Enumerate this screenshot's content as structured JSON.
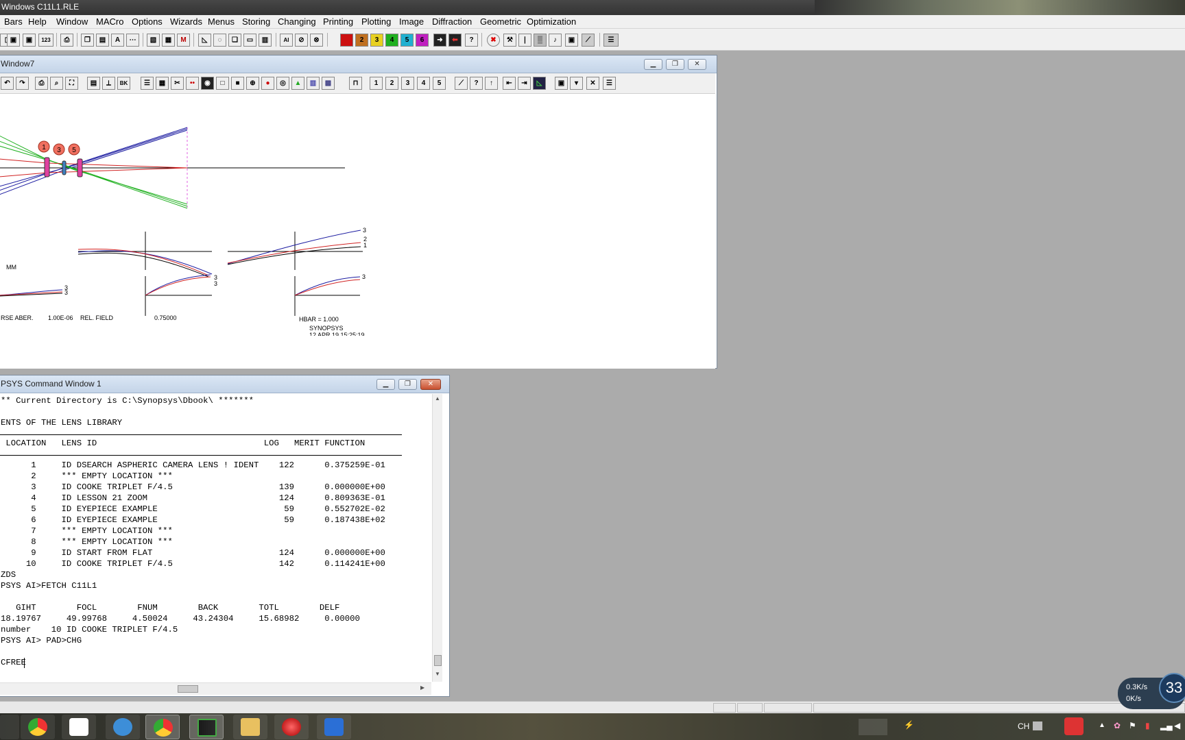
{
  "app": {
    "title": "Windows C11L1.RLE"
  },
  "menubar": {
    "items": [
      "Bars",
      "Help",
      "Window",
      "MACro",
      "Options",
      "Wizards",
      "Menus",
      "Storing",
      "Changing",
      "Printing",
      "Plotting",
      "Image",
      "Diffraction",
      "Geometric",
      "Optimization"
    ]
  },
  "main_toolbar": {
    "numbers_label": "123",
    "color_buttons": [
      {
        "label": "",
        "color": "#cc1010"
      },
      {
        "label": "2",
        "color": "#c07020"
      },
      {
        "label": "3",
        "color": "#e8d020"
      },
      {
        "label": "4",
        "color": "#20b020"
      },
      {
        "label": "5",
        "color": "#20b0d0"
      },
      {
        "label": "6",
        "color": "#c020c0"
      }
    ]
  },
  "graphics_window": {
    "title": "Window7",
    "zoom_tabs": [
      "1",
      "2",
      "3",
      "4",
      "5"
    ],
    "lens_markers": [
      "1",
      "3",
      "5"
    ],
    "units": "MM",
    "fan_labels": {
      "a1": "3",
      "a2": "3",
      "b1": "3",
      "b2": "3",
      "c1": "3",
      "c2": "2",
      "c3": "1",
      "d1": "3"
    },
    "footer": {
      "aber_label": "RSE ABER.",
      "aber_scale": "1.00E-06",
      "rel_field_label": "REL. FIELD",
      "rel_field_value": "0.75000",
      "hbar": "HBAR = 1.000",
      "brand": "SYNOPSYS",
      "date": "12 APR 19  15:25:19"
    }
  },
  "command_window": {
    "title": "PSYS Command Window 1",
    "lines": [
      "** Current Directory is C:\\Synopsys\\Dbook\\ *******",
      "",
      "ENTS OF THE LENS LIBRARY",
      "",
      " LOCATION   LENS ID                                 LOG   MERIT FUNCTION",
      "",
      "      1     ID DSEARCH ASPHERIC CAMERA LENS ! IDENT    122      0.375259E-01",
      "      2     *** EMPTY LOCATION ***",
      "      3     ID COOKE TRIPLET F/4.5                     139      0.000000E+00",
      "      4     ID LESSON 21 ZOOM                          124      0.809363E-01",
      "      5     ID EYEPIECE EXAMPLE                         59      0.552702E-02",
      "      6     ID EYEPIECE EXAMPLE                         59      0.187438E+02",
      "      7     *** EMPTY LOCATION ***",
      "      8     *** EMPTY LOCATION ***",
      "      9     ID START FROM FLAT                         124      0.000000E+00",
      "     10     ID COOKE TRIPLET F/4.5                     142      0.114241E+00",
      "ZDS",
      "PSYS AI>FETCH C11L1",
      "",
      "   GIHT        FOCL        FNUM        BACK        TOTL        DELF",
      "18.19767     49.99768     4.50024     43.24304     15.68982     0.00000",
      "number    10 ID COOKE TRIPLET F/4.5",
      "PSYS AI> PAD>CHG",
      "",
      "CFREE"
    ]
  },
  "system_tray": {
    "language": "CH",
    "net_up": "0.3K/s",
    "net_down": "0K/s",
    "badge": "33"
  }
}
